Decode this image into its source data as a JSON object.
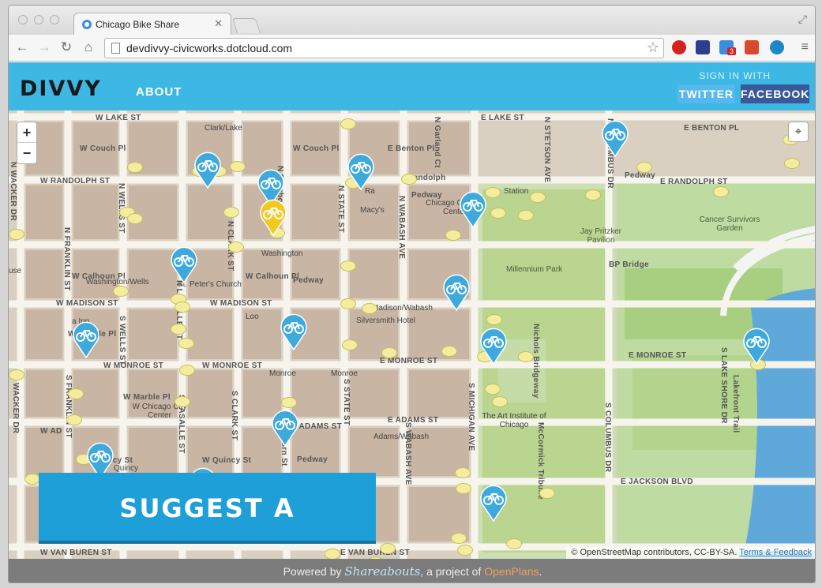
{
  "browser": {
    "tab_title": "Chicago Bike Share",
    "tab_close": "✕",
    "url": "devdivvy-civicworks.dotcloud.com",
    "ext_badge": "3",
    "nav": {
      "back": "←",
      "forward": "→",
      "reload": "↻",
      "home": "⌂"
    },
    "star": "☆",
    "menu": "≡",
    "fullscreen": "⤢"
  },
  "header": {
    "logo": "DIVVY",
    "about": "ABOUT",
    "sign_in_with": "SIGN IN WITH",
    "twitter": "TWITTER",
    "facebook": "FACEBOOK"
  },
  "map": {
    "zoom_in": "+",
    "zoom_out": "−",
    "locate": "⌖",
    "suggest_button": "SUGGEST A LOCATION",
    "attribution_text": "© OpenStreetMap contributors, CC-BY-SA.",
    "attribution_link": "Terms & Feedback",
    "streets": [
      {
        "t": "W LAKE ST"
      },
      {
        "t": "E LAKE ST"
      },
      {
        "t": "W RANDOLPH ST"
      },
      {
        "t": "E RANDOLPH ST"
      },
      {
        "t": "Randolph"
      },
      {
        "t": "W MADISON ST"
      },
      {
        "t": "W MADISON ST"
      },
      {
        "t": "W MONROE ST"
      },
      {
        "t": "W MONROE ST"
      },
      {
        "t": "E MONROE ST"
      },
      {
        "t": "E MONROE ST"
      },
      {
        "t": "E ADAMS ST"
      },
      {
        "t": "W ADAMS ST"
      },
      {
        "t": "W AD"
      },
      {
        "t": "E JACKSON BLVD"
      },
      {
        "t": "E VAN BUREN ST"
      },
      {
        "t": "W VAN BUREN ST"
      },
      {
        "t": "E BENTON PL"
      },
      {
        "t": "W Couch Pl"
      },
      {
        "t": "W Couch Pl"
      },
      {
        "t": "E Benton Pl"
      },
      {
        "t": "W Calhoun Pl"
      },
      {
        "t": "W Calhoun Pl"
      },
      {
        "t": "W Arcade Pl"
      },
      {
        "t": "W Marble Pl"
      },
      {
        "t": "W Quincy St"
      },
      {
        "t": "W Quincy St"
      },
      {
        "t": "Pedway"
      },
      {
        "t": "Pedway"
      },
      {
        "t": "Pedway"
      },
      {
        "t": "Pedway"
      },
      {
        "t": "BP Bridge"
      }
    ],
    "vstreets": [
      {
        "t": "N WACKER DR"
      },
      {
        "t": "N FRANKLIN ST"
      },
      {
        "t": "N WELLS ST"
      },
      {
        "t": "N LASALLE ST"
      },
      {
        "t": "N CLARK ST"
      },
      {
        "t": "N Dearborn St"
      },
      {
        "t": "N STATE ST"
      },
      {
        "t": "N WABASH AVE"
      },
      {
        "t": "N Garland Ct"
      },
      {
        "t": "N STETSON AVE"
      },
      {
        "t": "N COLUMBUS DR"
      },
      {
        "t": "S WACKER DR"
      },
      {
        "t": "S FRANKLIN ST"
      },
      {
        "t": "S WELLS ST"
      },
      {
        "t": "S LASALLE ST"
      },
      {
        "t": "S CLARK ST"
      },
      {
        "t": "S Dearborn St"
      },
      {
        "t": "S STATE ST"
      },
      {
        "t": "S WABASH AVE"
      },
      {
        "t": "S MICHIGAN AVE"
      },
      {
        "t": "S COLUMBUS DR"
      },
      {
        "t": "S LAKE SHORE DR"
      },
      {
        "t": "Nichols Bridgeway"
      },
      {
        "t": "McCormick Tribune"
      },
      {
        "t": "Lakefront Trail"
      }
    ],
    "pois": [
      {
        "t": "Clark/Lake"
      },
      {
        "t": "Washington"
      },
      {
        "t": "Washington/Wells"
      },
      {
        "t": "St. Peter's Church"
      },
      {
        "t": "Macy's"
      },
      {
        "t": "Chicago Cultural Center"
      },
      {
        "t": "Madison/Wabash"
      },
      {
        "t": "Silversmith Hotel"
      },
      {
        "t": "Monroe"
      },
      {
        "t": "Monroe"
      },
      {
        "t": "Adams/Wabash"
      },
      {
        "t": "W Chicago City Center"
      },
      {
        "t": "The Art Institute of Chicago"
      },
      {
        "t": "Jay Pritzker Pavilion"
      },
      {
        "t": "Millennium Park"
      },
      {
        "t": "Cancer Survivors Garden"
      },
      {
        "t": "Loo"
      },
      {
        "t": "a Inn"
      },
      {
        "t": "Quincy"
      },
      {
        "t": "Ra"
      },
      {
        "t": "Station"
      },
      {
        "t": "use"
      }
    ]
  },
  "footer": {
    "powered_by": "Powered by ",
    "brand": "Shareabouts",
    "project_of": ", a project of ",
    "openplans": "OpenPlans",
    "period": "."
  }
}
